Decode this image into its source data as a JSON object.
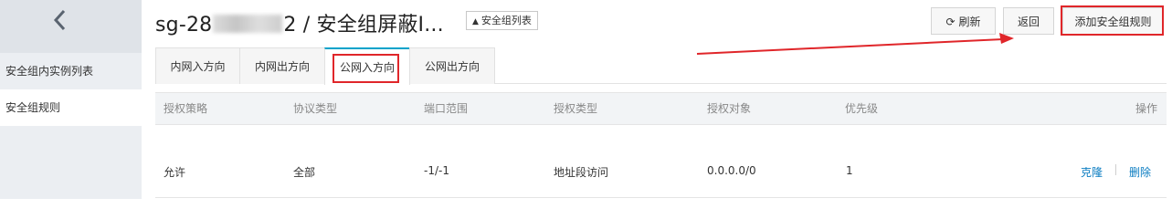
{
  "sidebar": {
    "items": [
      {
        "label": "安全组内实例列表"
      },
      {
        "label": "安全组规则"
      }
    ]
  },
  "header": {
    "title_prefix": "sg-28",
    "title_suffix": "2 / 安全组屏蔽I...",
    "list_button": "安全组列表",
    "refresh_label": "刷新",
    "back_label": "返回",
    "add_rule_label": "添加安全组规则"
  },
  "tabs": [
    {
      "label": "内网入方向"
    },
    {
      "label": "内网出方向"
    },
    {
      "label": "公网入方向"
    },
    {
      "label": "公网出方向"
    }
  ],
  "table": {
    "headers": [
      "授权策略",
      "协议类型",
      "端口范围",
      "授权类型",
      "授权对象",
      "优先级",
      "操作"
    ],
    "rows": [
      {
        "policy": "允许",
        "protocol": "全部",
        "port": "-1/-1",
        "auth_type": "地址段访问",
        "auth_object": "0.0.0.0/0",
        "priority": "1",
        "clone": "克隆",
        "delete": "删除"
      }
    ]
  },
  "colors": {
    "accent": "#00a2ca",
    "highlight": "#e0262a",
    "link": "#0a7cc1"
  }
}
